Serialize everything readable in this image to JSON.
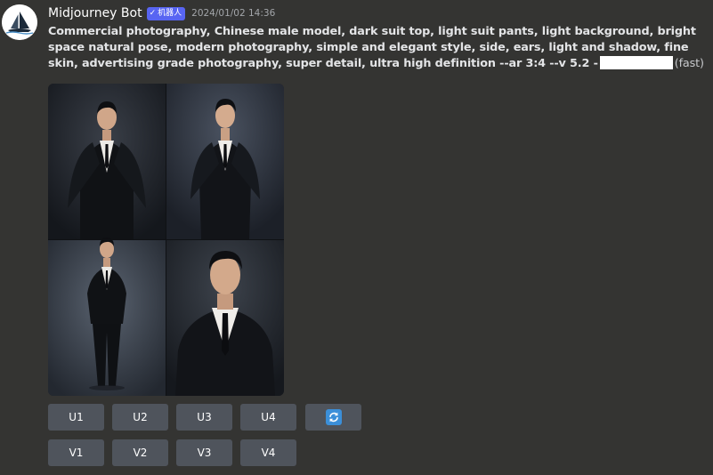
{
  "message": {
    "author": "Midjourney Bot",
    "bot_tag": "机器人",
    "bot_tag_check": "✓",
    "timestamp": "2024/01/02 14:36",
    "prompt": "Commercial photography, Chinese male model, dark suit top, light suit pants, light background, bright space natural pose, modern photography, simple and elegant style, side, ears, light and shadow, fine skin, advertising grade photography, super detail, ultra high definition --ar 3:4 --v 5.2 -",
    "speed": "(fast)"
  },
  "buttons": {
    "row1": [
      "U1",
      "U2",
      "U3",
      "U4"
    ],
    "row2": [
      "V1",
      "V2",
      "V3",
      "V4"
    ],
    "reroll_icon": "refresh-icon"
  },
  "colors": {
    "background": "#343432",
    "button": "#4f545c",
    "bot_tag": "#5865f2",
    "reroll_accent": "#3b8fd9"
  }
}
